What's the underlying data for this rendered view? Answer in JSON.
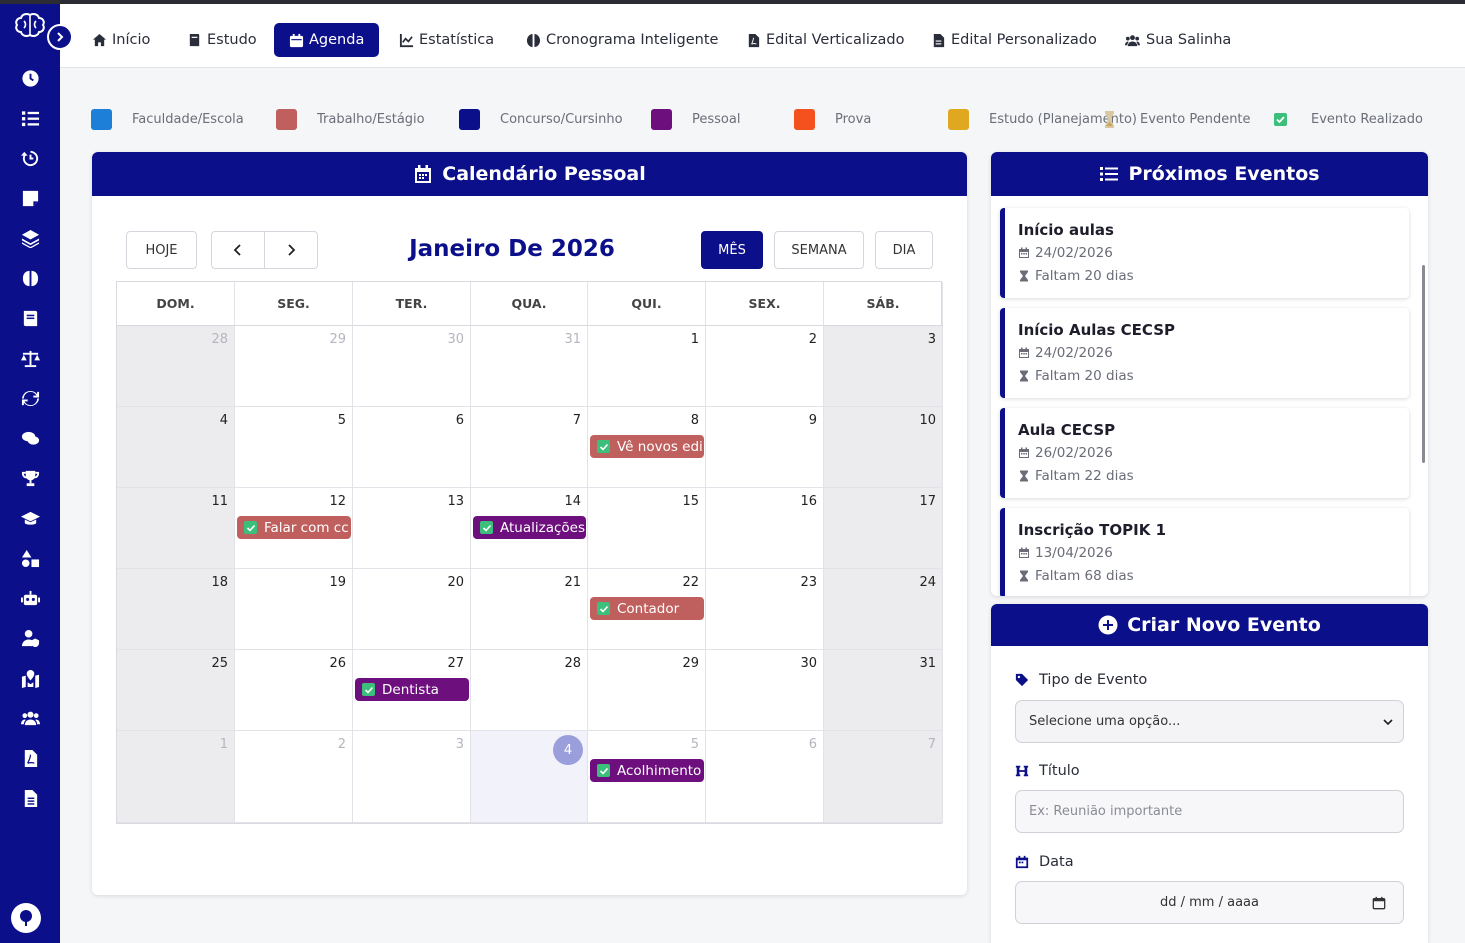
{
  "nav": {
    "items": [
      {
        "label": "Início",
        "icon": "home-icon"
      },
      {
        "label": "Estudo",
        "icon": "book-icon"
      },
      {
        "label": "Agenda",
        "icon": "calendar-icon",
        "active": true
      },
      {
        "label": "Estatística",
        "icon": "chart-line-icon"
      },
      {
        "label": "Cronograma Inteligente",
        "icon": "brain-icon"
      },
      {
        "label": "Edital Verticalizado",
        "icon": "pdf-file-icon"
      },
      {
        "label": "Edital Personalizado",
        "icon": "file-icon"
      },
      {
        "label": "Sua Salinha",
        "icon": "users-icon"
      }
    ]
  },
  "legend": [
    {
      "label": "Faculdade/Escola",
      "color": "#1e7fd8"
    },
    {
      "label": "Trabalho/Estágio",
      "color": "#c0605e"
    },
    {
      "label": "Concurso/Cursinho",
      "color": "#0b0f8a"
    },
    {
      "label": "Pessoal",
      "color": "#6e0f7e"
    },
    {
      "label": "Prova",
      "color": "#f4511e"
    },
    {
      "label": "Estudo (Planejamento)",
      "color": "#e0a820"
    },
    {
      "label": "Evento Pendente",
      "icon": "hourglass-icon"
    },
    {
      "label": "Evento Realizado",
      "icon": "check-square-icon"
    }
  ],
  "calendar": {
    "header": "Calendário Pessoal",
    "today_label": "HOJE",
    "title": "Janeiro De 2026",
    "views": [
      "MÊS",
      "SEMANA",
      "DIA"
    ],
    "active_view": "MÊS",
    "weekdays": [
      "DOM.",
      "SEG.",
      "TER.",
      "QUA.",
      "QUI.",
      "SEX.",
      "SÁB."
    ],
    "weeks": [
      [
        "28",
        "29",
        "30",
        "31",
        "1",
        "2",
        "3"
      ],
      [
        "4",
        "5",
        "6",
        "7",
        "8",
        "9",
        "10"
      ],
      [
        "11",
        "12",
        "13",
        "14",
        "15",
        "16",
        "17"
      ],
      [
        "18",
        "19",
        "20",
        "21",
        "22",
        "23",
        "24"
      ],
      [
        "25",
        "26",
        "27",
        "28",
        "29",
        "30",
        "31"
      ],
      [
        "1",
        "2",
        "3",
        "4",
        "5",
        "6",
        "7"
      ]
    ],
    "events": [
      {
        "title": "Vê novos edi",
        "week": 1,
        "day": 4,
        "color": "#c0605e"
      },
      {
        "title": "Falar com cc",
        "week": 2,
        "day": 1,
        "color": "#c0605e"
      },
      {
        "title": "Atualizações",
        "week": 2,
        "day": 3,
        "color": "#6e0f7e"
      },
      {
        "title": "Contador",
        "week": 3,
        "day": 4,
        "color": "#c0605e"
      },
      {
        "title": "Dentista",
        "week": 4,
        "day": 2,
        "color": "#6e0f7e"
      },
      {
        "title": "Acolhimento",
        "week": 5,
        "day": 4,
        "color": "#6e0f7e"
      }
    ]
  },
  "upcoming": {
    "header": "Próximos Eventos",
    "items": [
      {
        "title": "Início aulas",
        "date": "24/02/2026",
        "remaining": "Faltam 20 dias"
      },
      {
        "title": "Início Aulas CECSP",
        "date": "24/02/2026",
        "remaining": "Faltam 20 dias"
      },
      {
        "title": "Aula CECSP",
        "date": "26/02/2026",
        "remaining": "Faltam 22 dias"
      },
      {
        "title": "Inscrição TOPIK 1",
        "date": "13/04/2026",
        "remaining": "Faltam 68 dias"
      }
    ]
  },
  "new_event": {
    "header": "Criar Novo Evento",
    "type_label": "Tipo de Evento",
    "type_value": "Selecione uma opção...",
    "title_label": "Título",
    "title_placeholder": "Ex: Reunião importante",
    "date_label": "Data",
    "date_placeholder": "dd / mm / aaaa"
  }
}
